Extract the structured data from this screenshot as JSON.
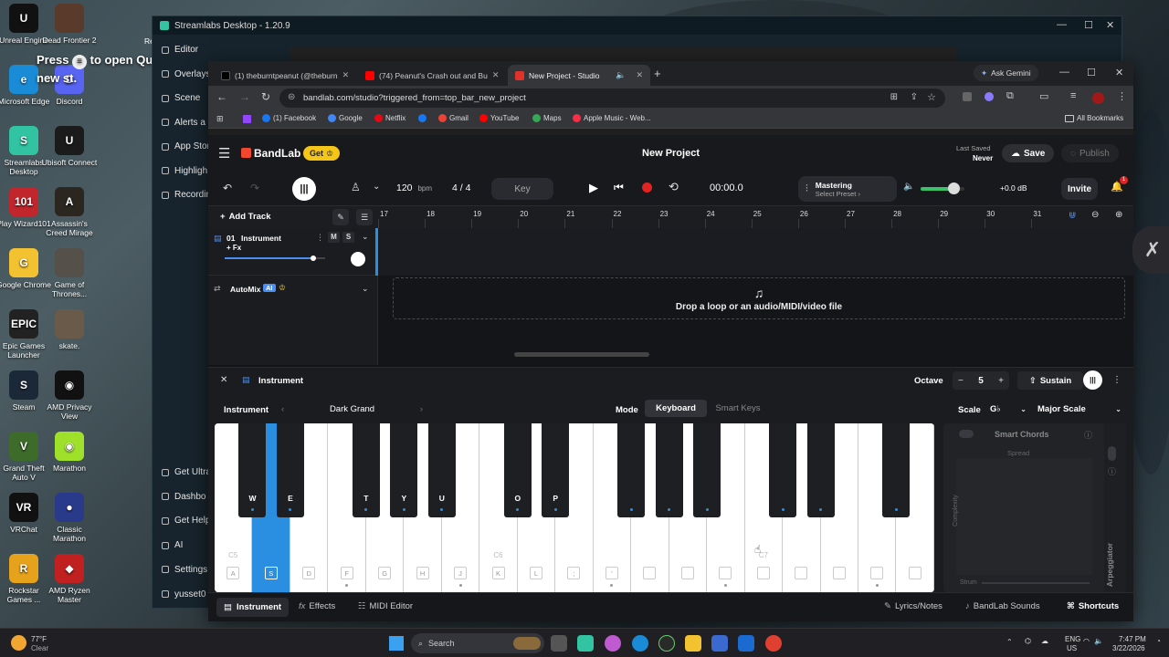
{
  "desktop": {
    "icons": [
      {
        "label": "Unreal Engine",
        "icon": "unreal-icon",
        "color": "#111111",
        "glyph": "U"
      },
      {
        "label": "Dead Frontier 2",
        "icon": "game-icon",
        "color": "#5a3a2a",
        "glyph": ""
      },
      {
        "label": "Microsoft Edge",
        "icon": "edge-icon",
        "color": "#1a8bd6",
        "glyph": "e"
      },
      {
        "label": "Discord",
        "icon": "discord-icon",
        "color": "#5865f2",
        "glyph": "D"
      },
      {
        "label": "Streamlabs Desktop",
        "icon": "streamlabs-icon",
        "color": "#31c3a2",
        "glyph": "S"
      },
      {
        "label": "Ubisoft Connect",
        "icon": "ubisoft-icon",
        "color": "#1b1b1b",
        "glyph": "U"
      },
      {
        "label": "Play Wizard101",
        "icon": "wizard-icon",
        "color": "#c0262c",
        "glyph": "101"
      },
      {
        "label": "Assassin's Creed Mirage",
        "icon": "ac-icon",
        "color": "#2b2620",
        "glyph": "A"
      },
      {
        "label": "Google Chrome",
        "icon": "chrome-icon",
        "color": "#f2c230",
        "glyph": "G"
      },
      {
        "label": "Game of Thrones...",
        "icon": "got-icon",
        "color": "#55504a",
        "glyph": ""
      },
      {
        "label": "Epic Games Launcher",
        "icon": "epic-icon",
        "color": "#222222",
        "glyph": "EPIC"
      },
      {
        "label": "skate.",
        "icon": "skate-icon",
        "color": "#6a5a4a",
        "glyph": ""
      },
      {
        "label": "Steam",
        "icon": "steam-icon",
        "color": "#1b2838",
        "glyph": "S"
      },
      {
        "label": "AMD Privacy View",
        "icon": "amd-icon",
        "color": "#111111",
        "glyph": "◉"
      },
      {
        "label": "Grand Theft Auto V",
        "icon": "gta-icon",
        "color": "#3c6b2a",
        "glyph": "V"
      },
      {
        "label": "Marathon",
        "icon": "marathon-icon",
        "color": "#9ee02a",
        "glyph": "◉"
      },
      {
        "label": "VRChat",
        "icon": "vrchat-icon",
        "color": "#111111",
        "glyph": "VR"
      },
      {
        "label": "Classic Marathon",
        "icon": "classic-marathon-icon",
        "color": "#2a3a8a",
        "glyph": "●"
      },
      {
        "label": "Rockstar Games ...",
        "icon": "rockstar-icon",
        "color": "#e6a21a",
        "glyph": "R"
      },
      {
        "label": "AMD Ryzen Master",
        "icon": "ryzen-icon",
        "color": "#c02020",
        "glyph": "◆"
      }
    ],
    "overlay_text": "Press",
    "overlay_text2": "to open Qu",
    "overlay_text3": "new",
    "overlay_text4": "st.",
    "edge_label": "Re"
  },
  "streamlabs": {
    "title": "Streamlabs Desktop - 1.20.9",
    "nav_top": [
      "Editor",
      "Overlays",
      "Scene",
      "Alerts a",
      "App Stor",
      "Highligh",
      "Recordin"
    ],
    "nav_bottom": [
      "Get Ultra",
      "Dashbo",
      "Get Help",
      "AI",
      "Settings",
      "yusset0"
    ]
  },
  "chrome": {
    "tabs": [
      {
        "title": "(1) theburntpeanut (@theburn",
        "favicon": "#000000"
      },
      {
        "title": "(74) Peanut's Crash out and Bu",
        "favicon": "#ff0000"
      },
      {
        "title": "New Project - Studio",
        "favicon": "#e0322a"
      }
    ],
    "gemini": "Ask Gemini",
    "url": "bandlab.com/studio?triggered_from=top_bar_new_project",
    "bookmarks": [
      {
        "label": "(1) Facebook",
        "color": "#1877f2"
      },
      {
        "label": "Google",
        "color": "#4285f4"
      },
      {
        "label": "Netflix",
        "color": "#e50914"
      },
      {
        "label": "",
        "color": "#1877f2"
      },
      {
        "label": "Gmail",
        "color": "#ea4335"
      },
      {
        "label": "YouTube",
        "color": "#ff0000"
      },
      {
        "label": "Maps",
        "color": "#34a853"
      },
      {
        "label": "Apple Music - Web...",
        "color": "#fa2d48"
      }
    ],
    "all_bookmarks": "All Bookmarks"
  },
  "bandlab": {
    "brand": "BandLab",
    "get": "Get",
    "project_title": "New Project",
    "last_saved_label": "Last Saved",
    "last_saved_value": "Never",
    "save": "Save",
    "publish": "Publish",
    "tempo": "120",
    "tempo_unit": "bpm",
    "time_sig": "4 / 4",
    "key": "Key",
    "time": "00:00.0",
    "mastering": "Mastering",
    "mastering_sub": "Select Preset",
    "volume": "+0.0 dB",
    "volume_level": 0.75,
    "invite": "Invite",
    "notif_count": "1",
    "add_track": "Add Track",
    "ruler": [
      "17",
      "18",
      "19",
      "20",
      "21",
      "22",
      "23",
      "24",
      "25",
      "26",
      "27",
      "28",
      "29",
      "30",
      "31"
    ],
    "track": {
      "number": "01",
      "name": "Instrument",
      "fx": "+ Fx",
      "mute": "M",
      "solo": "S",
      "volume_level": 0.88
    },
    "automix": "AutoMix",
    "ai_badge": "AI",
    "drop_text": "Drop a loop or an audio/MIDI/video file",
    "panel": {
      "title": "Instrument",
      "octave_label": "Octave",
      "octave_value": "5",
      "sustain": "Sustain",
      "instrument_label": "Instrument",
      "instrument_value": "Dark Grand",
      "mode_label": "Mode",
      "mode_keyboard": "Keyboard",
      "mode_smart": "Smart Keys",
      "scale_label": "Scale",
      "scale_key": "G♭",
      "scale_value": "Major Scale",
      "smart_chords": "Smart Chords",
      "spread": "Spread",
      "complexity": "Complexity",
      "strum": "Strum",
      "arpeggiator": "Arpeggiator"
    },
    "white_keys": [
      {
        "label": "A",
        "note": "C5",
        "dot": false
      },
      {
        "label": "S",
        "note": "",
        "dot": false
      },
      {
        "label": "D",
        "note": "",
        "dot": false
      },
      {
        "label": "F",
        "note": "",
        "dot": true
      },
      {
        "label": "G",
        "note": "",
        "dot": false
      },
      {
        "label": "H",
        "note": "",
        "dot": false
      },
      {
        "label": "J",
        "note": "",
        "dot": true
      },
      {
        "label": "K",
        "note": "C6",
        "dot": false
      },
      {
        "label": "L",
        "note": "",
        "dot": false
      },
      {
        "label": ";",
        "note": "",
        "dot": false
      },
      {
        "label": "'",
        "note": "",
        "dot": true
      },
      {
        "label": "",
        "note": "",
        "dot": false
      },
      {
        "label": "",
        "note": "",
        "dot": false
      },
      {
        "label": "",
        "note": "",
        "dot": true
      },
      {
        "label": "",
        "note": "C7",
        "dot": false
      },
      {
        "label": "",
        "note": "",
        "dot": false
      },
      {
        "label": "",
        "note": "",
        "dot": false
      },
      {
        "label": "",
        "note": "",
        "dot": true
      },
      {
        "label": "",
        "note": "",
        "dot": false
      }
    ],
    "black_keys": [
      {
        "label": "W"
      },
      {
        "label": "E"
      },
      {
        "label": "T"
      },
      {
        "label": "Y"
      },
      {
        "label": "U"
      },
      {
        "label": "O"
      },
      {
        "label": "P"
      },
      {
        "label": ""
      },
      {
        "label": ""
      },
      {
        "label": ""
      },
      {
        "label": ""
      },
      {
        "label": ""
      },
      {
        "label": ""
      }
    ],
    "bottom": {
      "instrument": "Instrument",
      "effects": "Effects",
      "midi": "MIDI Editor",
      "lyrics": "Lyrics/Notes",
      "sounds": "BandLab Sounds",
      "shortcuts": "Shortcuts"
    }
  },
  "taskbar": {
    "weather_temp": "77°F",
    "weather_desc": "Clear",
    "search": "Search",
    "lang1": "ENG",
    "lang2": "US",
    "time": "7:47 PM",
    "date": "3/22/2026"
  }
}
